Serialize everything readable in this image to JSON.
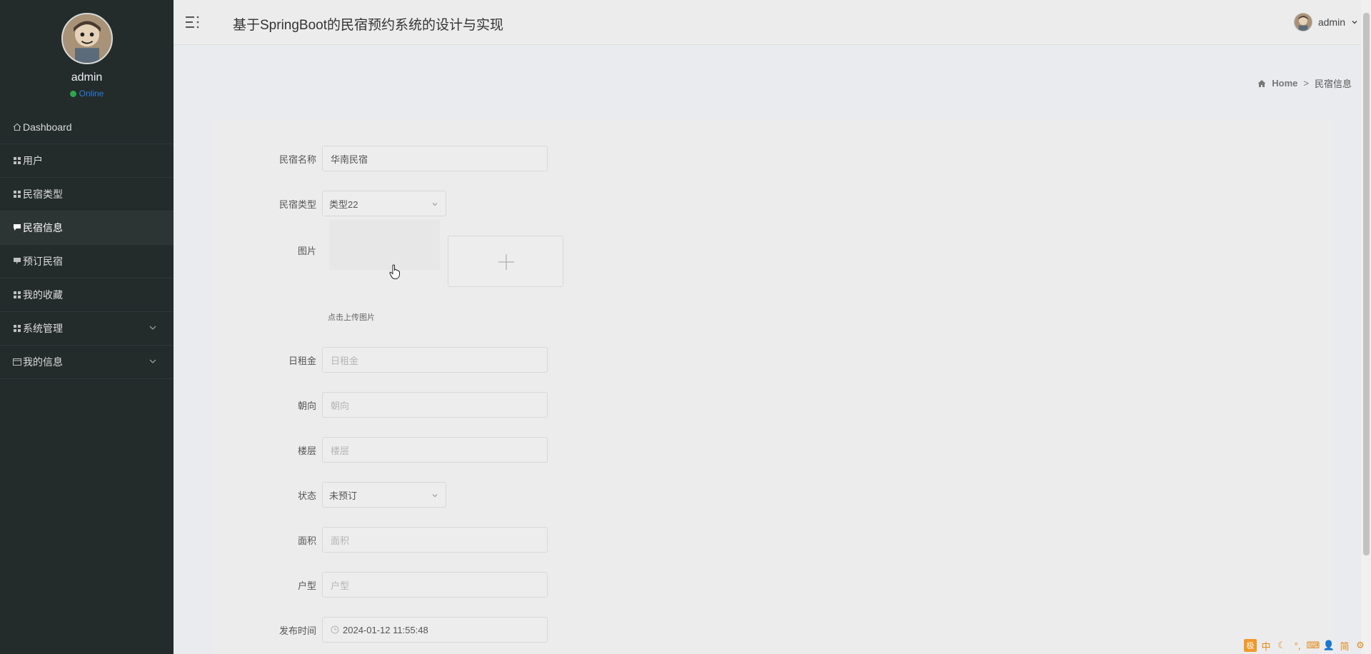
{
  "app": {
    "title": "基于SpringBoot的民宿预约系统的设计与实现"
  },
  "header": {
    "user_name": "admin"
  },
  "sidebar": {
    "profile": {
      "name": "admin",
      "status": "Online"
    },
    "items": [
      {
        "label": "Dashboard",
        "icon": "home-icon"
      },
      {
        "label": "用户",
        "icon": "grid-icon"
      },
      {
        "label": "民宿类型",
        "icon": "grid-icon"
      },
      {
        "label": "民宿信息",
        "icon": "comment-icon",
        "active": true
      },
      {
        "label": "预订民宿",
        "icon": "comment-icon"
      },
      {
        "label": "我的收藏",
        "icon": "grid-icon"
      },
      {
        "label": "系统管理",
        "icon": "grid-icon",
        "expandable": true
      },
      {
        "label": "我的信息",
        "icon": "card-icon",
        "expandable": true
      }
    ]
  },
  "breadcrumb": {
    "home": "Home",
    "separator": ">",
    "current": "民宿信息"
  },
  "form": {
    "name": {
      "label": "民宿名称",
      "value": "华南民宿"
    },
    "type": {
      "label": "民宿类型",
      "value": "类型22"
    },
    "image": {
      "label": "图片",
      "hint": "点击上传图片"
    },
    "daily_rent": {
      "label": "日租金",
      "placeholder": "日租金"
    },
    "orientation": {
      "label": "朝向",
      "placeholder": "朝向"
    },
    "floor": {
      "label": "楼层",
      "placeholder": "楼层"
    },
    "status": {
      "label": "状态",
      "value": "未预订"
    },
    "area": {
      "label": "面积",
      "placeholder": "面积"
    },
    "layout": {
      "label": "户型",
      "placeholder": "户型"
    },
    "publish_time": {
      "label": "发布时间",
      "value": "2024-01-12 11:55:48"
    }
  },
  "ime_toolbar": {
    "logo": "极",
    "mode": "中",
    "script": "简"
  },
  "colors": {
    "sidebar_bg": "#232b2b",
    "status_online": "#2ea44f",
    "status_text": "#2c7bd9",
    "ime_accent": "#e08a1a"
  }
}
